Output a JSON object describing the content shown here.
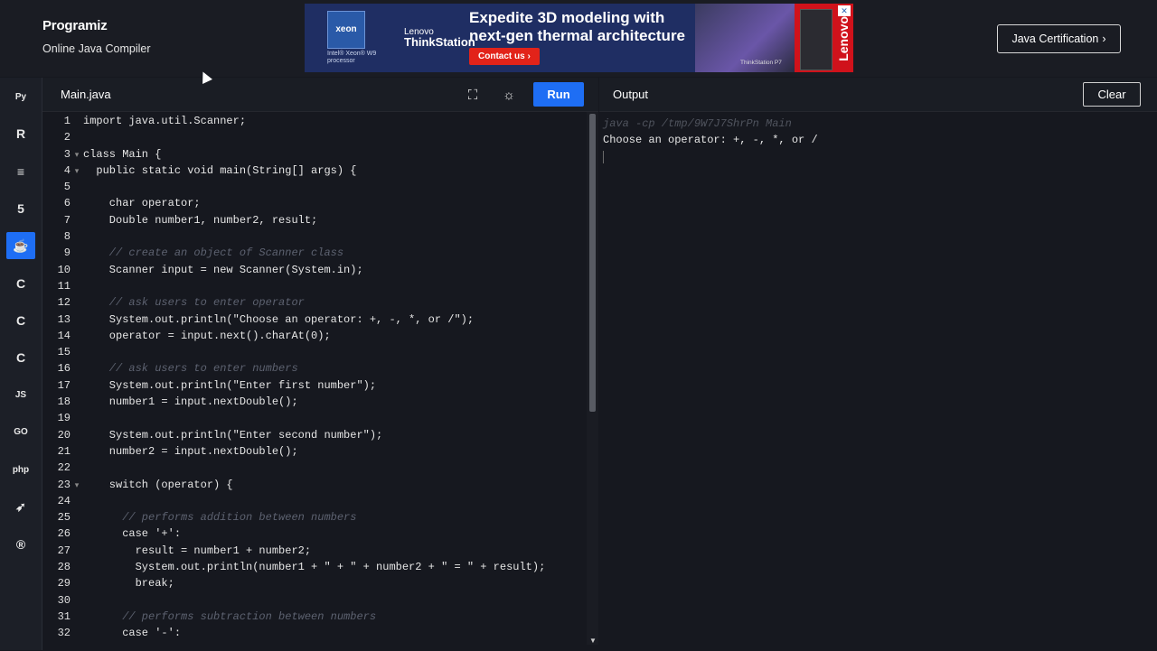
{
  "brand": {
    "logo": "Programiz",
    "subtitle": "Online Java Compiler"
  },
  "ad": {
    "intel_badge": "xeon",
    "intel_caption": "Intel® Xeon® W9 processor",
    "lenovo_small": "Lenovo",
    "lenovo_product": "ThinkStation",
    "headline": "Expedite 3D modeling with next-gen thermal architecture",
    "cta": "Contact us",
    "image_caption": "ThinkStation P7",
    "brand": "Lenovo"
  },
  "header": {
    "cert_button": "Java Certification",
    "cert_arrow": "›"
  },
  "sidebar": {
    "items": [
      {
        "name": "python-icon",
        "glyph": "Py"
      },
      {
        "name": "r-icon",
        "glyph": "R"
      },
      {
        "name": "sql-icon",
        "glyph": "≡"
      },
      {
        "name": "html-icon",
        "glyph": "5"
      },
      {
        "name": "java-icon",
        "glyph": "☕"
      },
      {
        "name": "c-icon",
        "glyph": "C"
      },
      {
        "name": "cpp-icon",
        "glyph": "C"
      },
      {
        "name": "csharp-icon",
        "glyph": "C"
      },
      {
        "name": "javascript-icon",
        "glyph": "JS"
      },
      {
        "name": "go-icon",
        "glyph": "GO"
      },
      {
        "name": "php-icon",
        "glyph": "php"
      },
      {
        "name": "swift-icon",
        "glyph": "➶"
      },
      {
        "name": "rust-icon",
        "glyph": "®"
      }
    ]
  },
  "editor": {
    "file_tab": "Main.java",
    "fullscreen_glyph": "⛶",
    "theme_glyph": "☼",
    "run_label": "Run",
    "lines": [
      {
        "n": "1",
        "fold": "",
        "text": "import java.util.Scanner;",
        "cls": "code"
      },
      {
        "n": "2",
        "fold": "",
        "text": "",
        "cls": "code"
      },
      {
        "n": "3",
        "fold": "▾",
        "text": "class Main {",
        "cls": "code"
      },
      {
        "n": "4",
        "fold": "▾",
        "text": "  public static void main(String[] args) {",
        "cls": "code"
      },
      {
        "n": "5",
        "fold": "",
        "text": "",
        "cls": "code"
      },
      {
        "n": "6",
        "fold": "",
        "text": "    char operator;",
        "cls": "code"
      },
      {
        "n": "7",
        "fold": "",
        "text": "    Double number1, number2, result;",
        "cls": "code"
      },
      {
        "n": "8",
        "fold": "",
        "text": "",
        "cls": "code"
      },
      {
        "n": "9",
        "fold": "",
        "text": "    // create an object of Scanner class",
        "cls": "cmt"
      },
      {
        "n": "10",
        "fold": "",
        "text": "    Scanner input = new Scanner(System.in);",
        "cls": "code"
      },
      {
        "n": "11",
        "fold": "",
        "text": "",
        "cls": "code"
      },
      {
        "n": "12",
        "fold": "",
        "text": "    // ask users to enter operator",
        "cls": "cmt"
      },
      {
        "n": "13",
        "fold": "",
        "text": "    System.out.println(\"Choose an operator: +, -, *, or /\");",
        "cls": "code"
      },
      {
        "n": "14",
        "fold": "",
        "text": "    operator = input.next().charAt(0);",
        "cls": "code"
      },
      {
        "n": "15",
        "fold": "",
        "text": "",
        "cls": "code"
      },
      {
        "n": "16",
        "fold": "",
        "text": "    // ask users to enter numbers",
        "cls": "cmt"
      },
      {
        "n": "17",
        "fold": "",
        "text": "    System.out.println(\"Enter first number\");",
        "cls": "code"
      },
      {
        "n": "18",
        "fold": "",
        "text": "    number1 = input.nextDouble();",
        "cls": "code"
      },
      {
        "n": "19",
        "fold": "",
        "text": "",
        "cls": "code"
      },
      {
        "n": "20",
        "fold": "",
        "text": "    System.out.println(\"Enter second number\");",
        "cls": "code"
      },
      {
        "n": "21",
        "fold": "",
        "text": "    number2 = input.nextDouble();",
        "cls": "code"
      },
      {
        "n": "22",
        "fold": "",
        "text": "",
        "cls": "code"
      },
      {
        "n": "23",
        "fold": "▾",
        "text": "    switch (operator) {",
        "cls": "code"
      },
      {
        "n": "24",
        "fold": "",
        "text": "",
        "cls": "code"
      },
      {
        "n": "25",
        "fold": "",
        "text": "      // performs addition between numbers",
        "cls": "cmt"
      },
      {
        "n": "26",
        "fold": "",
        "text": "      case '+':",
        "cls": "code"
      },
      {
        "n": "27",
        "fold": "",
        "text": "        result = number1 + number2;",
        "cls": "code"
      },
      {
        "n": "28",
        "fold": "",
        "text": "        System.out.println(number1 + \" + \" + number2 + \" = \" + result);",
        "cls": "code"
      },
      {
        "n": "29",
        "fold": "",
        "text": "        break;",
        "cls": "code"
      },
      {
        "n": "30",
        "fold": "",
        "text": "",
        "cls": "code"
      },
      {
        "n": "31",
        "fold": "",
        "text": "      // performs subtraction between numbers",
        "cls": "cmt"
      },
      {
        "n": "32",
        "fold": "",
        "text": "      case '-':",
        "cls": "code"
      }
    ]
  },
  "output": {
    "title": "Output",
    "clear_label": "Clear",
    "command": "java -cp /tmp/9W7J7ShrPn Main",
    "lines": [
      "Choose an operator: +, -, *, or /"
    ]
  },
  "colors": {
    "accent": "#1e6ef4",
    "background": "#16181f",
    "ad_red": "#e2231a"
  }
}
